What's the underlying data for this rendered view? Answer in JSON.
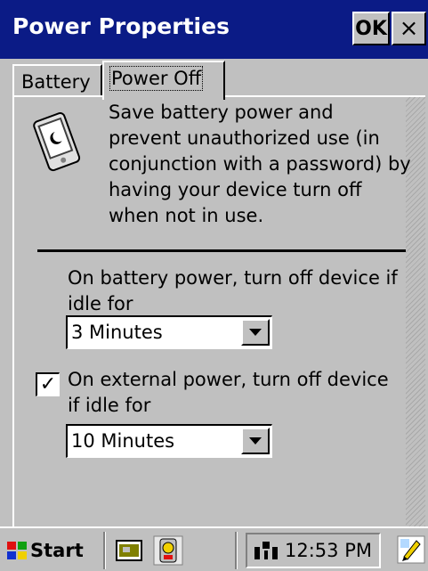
{
  "window": {
    "title": "Power Properties",
    "ok_label": "OK",
    "close_label": "×"
  },
  "tabs": [
    {
      "label": "Battery",
      "selected": false
    },
    {
      "label": "Power Off",
      "selected": true
    }
  ],
  "description": "Save battery power and prevent unauthorized use (in conjunction with a password) by having your device turn off when not in use.",
  "battery": {
    "label": "On battery power, turn off device if idle for",
    "value": "3 Minutes"
  },
  "external": {
    "checked": true,
    "check_glyph": "✓",
    "label": "On external power, turn off device if idle for",
    "value": "10 Minutes"
  },
  "taskbar": {
    "start_label": "Start",
    "clock": "12:53 PM"
  },
  "icons": {
    "device": "handheld-device-icon",
    "start": "windows-flag-icon",
    "network": "network-icon",
    "input": "pen-input-icon"
  },
  "colors": {
    "titlebar": "#0b1b86",
    "face": "#c0c0c0"
  }
}
